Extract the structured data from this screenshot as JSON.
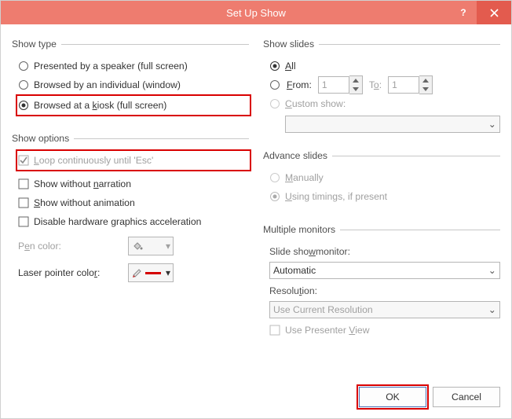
{
  "window_title": "Set Up Show",
  "show_type": {
    "legend": "Show type",
    "opt1": "Presented by a speaker (full screen)",
    "opt2": "Browsed by an individual (window)",
    "opt3_pre": "Browsed at a ",
    "opt3_key": "k",
    "opt3_post": "iosk (full screen)"
  },
  "show_options": {
    "legend": "Show options",
    "loop_pre": "",
    "loop_key": "L",
    "loop_post": "oop continuously until 'Esc'",
    "narration_pre": "Show without ",
    "narration_key": "n",
    "narration_post": "arration",
    "anim_pre": "",
    "anim_key": "S",
    "anim_post": "how without animation",
    "gfx_pre": "Disable hardware ",
    "gfx_key": "g",
    "gfx_post": "raphics acceleration",
    "pen_pre": "P",
    "pen_key": "e",
    "pen_post": "n color:",
    "laser_pre": "Laser pointer colo",
    "laser_key": "r",
    "laser_post": ":"
  },
  "show_slides": {
    "legend": "Show slides",
    "all": "All",
    "from_key": "F",
    "from_post": "rom:",
    "to_pre": "T",
    "to_key": "o",
    "to_post": ":",
    "custom_key": "C",
    "custom_post": "ustom show:",
    "from_val": "1",
    "to_val": "1"
  },
  "advance": {
    "legend": "Advance slides",
    "manual_key": "M",
    "manual_post": "anually",
    "timings_key": "U",
    "timings_post": "sing timings, if present"
  },
  "monitors": {
    "legend": "Multiple monitors",
    "monitor_pre": "Slide sho",
    "monitor_key": "w",
    "monitor_post": " monitor:",
    "monitor_value": "Automatic",
    "res_pre": "Resolu",
    "res_key": "t",
    "res_post": "ion:",
    "res_value": "Use Current Resolution",
    "presenter_pre": "Use Presenter ",
    "presenter_key": "V",
    "presenter_post": "iew"
  },
  "buttons": {
    "ok": "OK",
    "cancel": "Cancel"
  },
  "colors": {
    "pen": "#f8caa8",
    "laser": "#d40000"
  }
}
